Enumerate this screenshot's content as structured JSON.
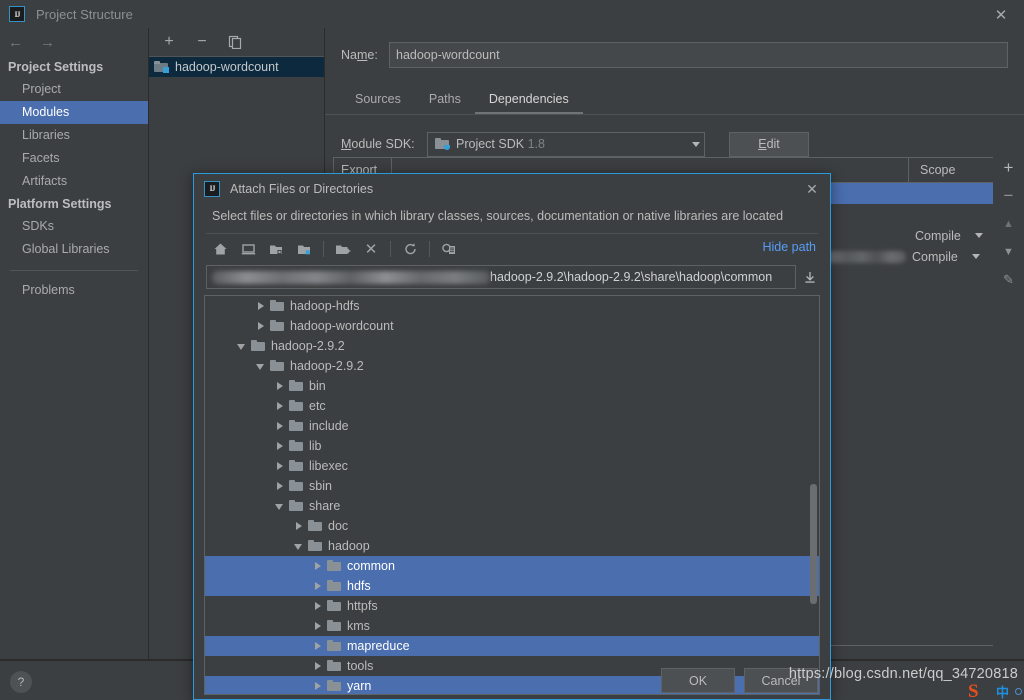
{
  "window": {
    "title": "Project Structure",
    "logo_text": "IJ",
    "close_icon": "✕"
  },
  "nav": {
    "back_icon": "←",
    "forward_icon": "→",
    "sections": [
      {
        "title": "Project Settings",
        "items": [
          {
            "label": "Project",
            "selected": false
          },
          {
            "label": "Modules",
            "selected": true
          },
          {
            "label": "Libraries",
            "selected": false
          },
          {
            "label": "Facets",
            "selected": false
          },
          {
            "label": "Artifacts",
            "selected": false
          }
        ]
      },
      {
        "title": "Platform Settings",
        "items": [
          {
            "label": "SDKs",
            "selected": false
          },
          {
            "label": "Global Libraries",
            "selected": false
          }
        ]
      }
    ],
    "extra": [
      {
        "label": "Problems",
        "selected": false
      }
    ]
  },
  "modules_panel": {
    "toolbar": [
      {
        "name": "add-module-button",
        "glyph": "+"
      },
      {
        "name": "remove-module-button",
        "glyph": "−"
      },
      {
        "name": "copy-module-button",
        "glyph": "❐"
      }
    ],
    "items": [
      {
        "label": "hadoop-wordcount",
        "selected": true
      }
    ]
  },
  "module_editor": {
    "name_label": "Name:",
    "name_value": "hadoop-wordcount",
    "tabs": [
      {
        "label": "Sources",
        "active": false
      },
      {
        "label": "Paths",
        "active": false
      },
      {
        "label": "Dependencies",
        "active": true
      }
    ],
    "sdk_label": "Module SDK:",
    "sdk_value": "Project SDK",
    "sdk_version": "1.8",
    "edit_button": "Edit",
    "dependencies_table": {
      "columns": [
        "Export",
        "",
        "Scope"
      ],
      "rows": [
        {
          "name": "",
          "scope": "",
          "selected": true,
          "blurred": false
        },
        {
          "name": "",
          "scope": "",
          "selected": false,
          "blurred": false
        },
        {
          "name": "",
          "scope": "Compile",
          "selected": false,
          "blurred": false
        },
        {
          "name": "",
          "scope": "Compile",
          "selected": false,
          "blurred": true
        }
      ]
    },
    "side_buttons": [
      {
        "name": "add-dependency-button",
        "glyph": "+"
      },
      {
        "name": "remove-dependency-button",
        "glyph": "−"
      },
      {
        "name": "move-up-button",
        "glyph": "▲"
      },
      {
        "name": "move-down-button",
        "glyph": "▼"
      },
      {
        "name": "edit-dependency-button",
        "glyph": "✎"
      }
    ]
  },
  "bottom": {
    "help_label": "?"
  },
  "dialog": {
    "title": "Attach Files or Directories",
    "logo_text": "IJ",
    "close_icon": "✕",
    "description": "Select files or directories in which library classes, sources, documentation or native libraries are located",
    "toolbar": [
      {
        "name": "home-icon",
        "title": "Home"
      },
      {
        "name": "desktop-icon",
        "title": "Desktop"
      },
      {
        "name": "project-folder-icon",
        "title": "Project"
      },
      {
        "name": "module-folder-icon",
        "title": "Module"
      },
      {
        "name": "new-folder-icon",
        "title": "New Folder"
      },
      {
        "name": "delete-icon",
        "title": "Delete"
      },
      {
        "name": "refresh-icon",
        "title": "Refresh"
      },
      {
        "name": "show-hidden-icon",
        "title": "Show Hidden Files"
      }
    ],
    "hide_path_label": "Hide path",
    "path_value": "hadoop-2.9.2\\hadoop-2.9.2\\share\\hadoop\\common",
    "path_prefix_redacted": true,
    "tree": [
      {
        "label": "hadoop-hdfs",
        "depth": 2,
        "state": "closed",
        "selected": false
      },
      {
        "label": "hadoop-wordcount",
        "depth": 2,
        "state": "closed",
        "selected": false
      },
      {
        "label": "hadoop-2.9.2",
        "depth": 1,
        "state": "open",
        "selected": false
      },
      {
        "label": "hadoop-2.9.2",
        "depth": 2,
        "state": "open",
        "selected": false
      },
      {
        "label": "bin",
        "depth": 3,
        "state": "closed",
        "selected": false
      },
      {
        "label": "etc",
        "depth": 3,
        "state": "closed",
        "selected": false
      },
      {
        "label": "include",
        "depth": 3,
        "state": "closed",
        "selected": false
      },
      {
        "label": "lib",
        "depth": 3,
        "state": "closed",
        "selected": false
      },
      {
        "label": "libexec",
        "depth": 3,
        "state": "closed",
        "selected": false
      },
      {
        "label": "sbin",
        "depth": 3,
        "state": "closed",
        "selected": false
      },
      {
        "label": "share",
        "depth": 3,
        "state": "open",
        "selected": false
      },
      {
        "label": "doc",
        "depth": 4,
        "state": "closed",
        "selected": false
      },
      {
        "label": "hadoop",
        "depth": 4,
        "state": "open",
        "selected": false
      },
      {
        "label": "common",
        "depth": 5,
        "state": "closed",
        "selected": true
      },
      {
        "label": "hdfs",
        "depth": 5,
        "state": "closed",
        "selected": true
      },
      {
        "label": "httpfs",
        "depth": 5,
        "state": "closed",
        "selected": false
      },
      {
        "label": "kms",
        "depth": 5,
        "state": "closed",
        "selected": false
      },
      {
        "label": "mapreduce",
        "depth": 5,
        "state": "closed",
        "selected": true
      },
      {
        "label": "tools",
        "depth": 5,
        "state": "closed",
        "selected": false
      },
      {
        "label": "yarn",
        "depth": 5,
        "state": "closed",
        "selected": true
      }
    ],
    "buttons": [
      {
        "label": "OK",
        "name": "ok-button"
      },
      {
        "label": "Cancel",
        "name": "cancel-button"
      }
    ]
  },
  "overlay": {
    "watermark": "https://blog.csdn.net/qq_34720818",
    "tray": {
      "ime_logo": "S",
      "ime_mode": "中",
      "ime_dot": "°"
    }
  },
  "colors": {
    "bg": "#3c3f41",
    "selection_blue": "#4b6eaf",
    "module_selection": "#0d293e",
    "dialog_border": "#2d9ae0",
    "link_blue": "#589df6",
    "accent_cyan": "#389fd6"
  }
}
